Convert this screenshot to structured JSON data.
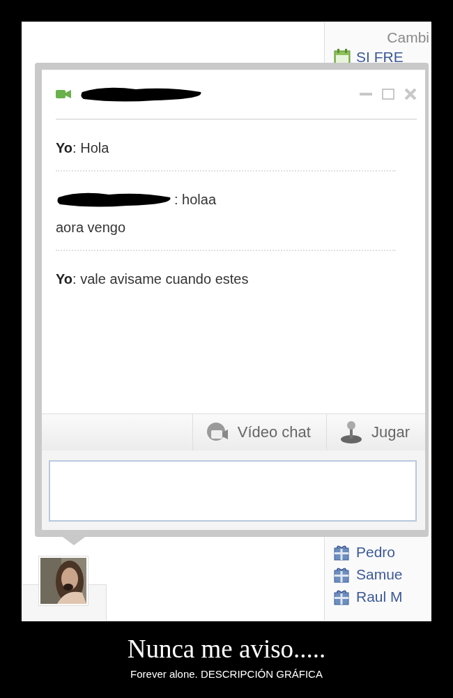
{
  "sidebar": {
    "heading": "Cambi",
    "event": "SI FRE",
    "birthdays": [
      {
        "name": "Pedro"
      },
      {
        "name": "Samue"
      },
      {
        "name": "Raul M"
      }
    ]
  },
  "chat": {
    "messages": [
      {
        "kind": "own",
        "lines": [
          "**Yo**: Hola"
        ]
      },
      {
        "kind": "redacted",
        "lines": [
          ": holaa",
          "aora vengo"
        ]
      },
      {
        "kind": "own",
        "lines": [
          "**Yo**: vale avisame cuando estes"
        ]
      }
    ],
    "toolbar": [
      {
        "kind": "video",
        "label": "Vídeo chat"
      },
      {
        "kind": "game",
        "label": "Jugar"
      }
    ]
  },
  "caption": {
    "title": "Nunca me aviso.....",
    "subtitle": "Forever alone. DESCRIPCIÓN GRÁFICA"
  }
}
